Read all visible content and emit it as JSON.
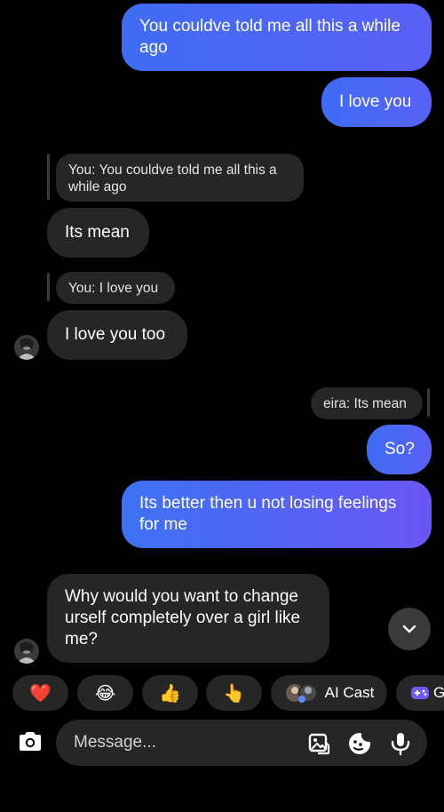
{
  "messages": [
    {
      "id": "m1",
      "dir": "out",
      "text": "You couldve told me all this a while ago"
    },
    {
      "id": "m2",
      "dir": "out",
      "text": "I love you"
    },
    {
      "id": "m3",
      "dir": "in",
      "reply_to": "You: You couldve told me all this a while ago",
      "text": "Its mean"
    },
    {
      "id": "m4",
      "dir": "in",
      "reply_to": "You: I love you",
      "text": "I love you too"
    },
    {
      "id": "m5",
      "dir": "out",
      "reply_to": "eira: Its mean",
      "text": "So?"
    },
    {
      "id": "m6",
      "dir": "out",
      "text": "Its better then u not losing feelings for me"
    },
    {
      "id": "m7",
      "dir": "in",
      "text": "Why would you want to change urself completely over a girl like me?"
    }
  ],
  "quick_reactions": [
    {
      "icon": "heart-emoji",
      "glyph": "❤️"
    },
    {
      "icon": "laughing-emoji",
      "glyph": "😂"
    },
    {
      "icon": "thumbs-up-emoji",
      "glyph": "👍"
    },
    {
      "icon": "pointing-hand-emoji",
      "glyph": "👆"
    },
    {
      "icon": "ai-cast-icon",
      "label": "AI Cast"
    },
    {
      "icon": "game-controller-icon",
      "label": "G"
    }
  ],
  "composer": {
    "placeholder": "Message...",
    "icons": [
      "camera-icon",
      "gallery-icon",
      "sticker-icon",
      "microphone-icon"
    ]
  },
  "colors": {
    "background": "#000000",
    "incoming_bubble": "#262626",
    "outgoing_bubble_start": "#3f6cf3",
    "outgoing_bubble_end": "#6a56f4"
  }
}
